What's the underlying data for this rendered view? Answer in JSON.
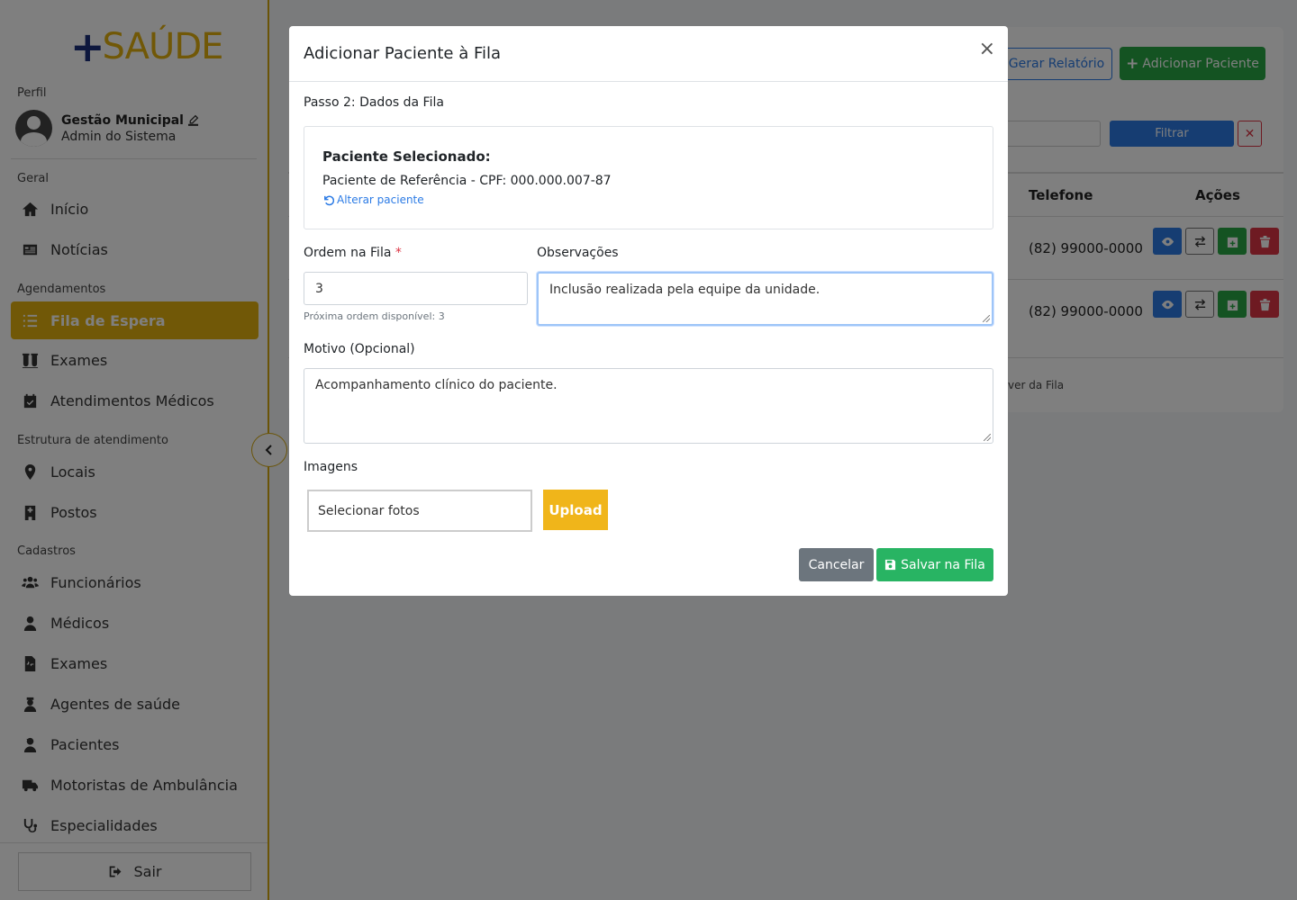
{
  "brand": {
    "plus": "+",
    "name": "SAÚDE",
    "plus_color": "#1b2f7a",
    "name_color": "#e2b10f"
  },
  "sidebar": {
    "profile_section": "Perfil",
    "user_name": "Gestão Municipal",
    "user_role": "Admin do Sistema",
    "sections": {
      "geral": "Geral",
      "agendamentos": "Agendamentos",
      "estrutura": "Estrutura de atendimento",
      "cadastros": "Cadastros"
    },
    "items": {
      "inicio": {
        "label": "Início",
        "icon": "home-icon"
      },
      "noticias": {
        "label": "Notícias",
        "icon": "newspaper-icon"
      },
      "fila": {
        "label": "Fila de Espera",
        "icon": "list-ol-icon"
      },
      "exames_ag": {
        "label": "Exames",
        "icon": "vials-icon"
      },
      "atendimentos": {
        "label": "Atendimentos Médicos",
        "icon": "calendar-check-icon"
      },
      "locais": {
        "label": "Locais",
        "icon": "map-marker-icon"
      },
      "postos": {
        "label": "Postos",
        "icon": "hospital-icon"
      },
      "funcionarios": {
        "label": "Funcionários",
        "icon": "users-icon"
      },
      "medicos": {
        "label": "Médicos",
        "icon": "user-md-icon"
      },
      "exames_cad": {
        "label": "Exames",
        "icon": "file-medical-icon"
      },
      "agentes": {
        "label": "Agentes de saúde",
        "icon": "user-nurse-icon"
      },
      "pacientes": {
        "label": "Pacientes",
        "icon": "user-injured-icon"
      },
      "motoristas": {
        "label": "Motoristas de Ambulância",
        "icon": "ambulance-icon"
      },
      "especialidades": {
        "label": "Especialidades",
        "icon": "stethoscope-icon"
      }
    },
    "active": "Fila de Espera",
    "logout": "Sair",
    "accent": "#e2b10f"
  },
  "background": {
    "report_button": "Gerar Relatório",
    "add_button": "Adicionar Paciente",
    "filter_button": "Filtrar",
    "columns": {
      "telefone": "Telefone",
      "acoes": "Ações"
    },
    "rows": [
      {
        "telefone": "(82) 99000-0000"
      },
      {
        "telefone": "(82) 99000-0000"
      }
    ],
    "footer_text": "ver da Fila"
  },
  "modal": {
    "title": "Adicionar Paciente à Fila",
    "close": "×",
    "step": "Passo 2: Dados da Fila",
    "selected_label": "Paciente Selecionado:",
    "selected_value": "Paciente de Referência - CPF: 000.000.007-87",
    "change_link": "Alterar paciente",
    "order_label": "Ordem na Fila",
    "required_mark": "*",
    "order_value": "3",
    "order_hint": "Próxima ordem disponível: 3",
    "obs_label": "Observações",
    "obs_value": "Inclusão realizada pela equipe da unidade.",
    "reason_label": "Motivo (Opcional)",
    "reason_value": "Acompanhamento clínico do paciente.",
    "images_label": "Imagens",
    "file_button": "Selecionar fotos",
    "upload_button": "Upload",
    "cancel_button": "Cancelar",
    "save_button": "Salvar na Fila",
    "colors": {
      "save": "#28b463",
      "cancel": "#6c757d",
      "upload": "#f0b51a",
      "link": "#2c7be5"
    }
  }
}
